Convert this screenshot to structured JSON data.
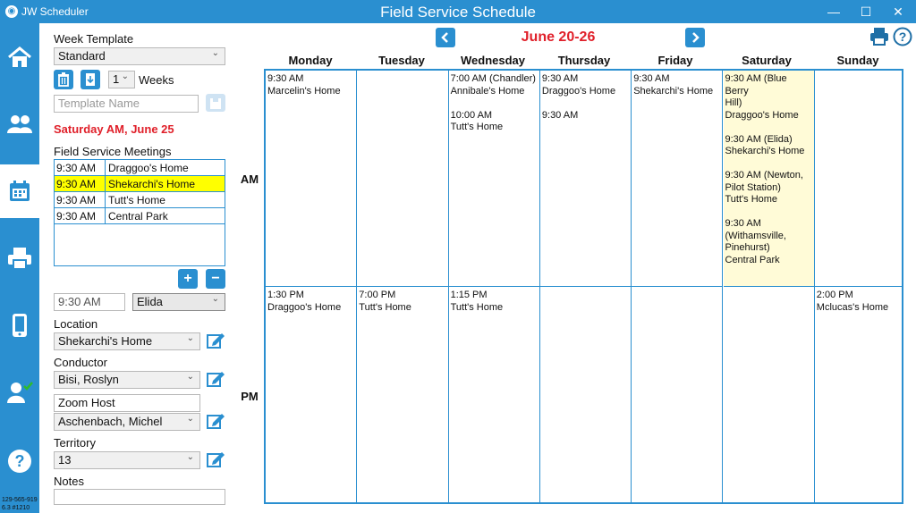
{
  "titlebar": {
    "app_name": "JW Scheduler",
    "window_title": "Field Service Schedule"
  },
  "sidebar": {
    "items": [
      {
        "icon": "home-icon"
      },
      {
        "icon": "users-icon"
      },
      {
        "icon": "calendar-icon"
      },
      {
        "icon": "printer-icon"
      },
      {
        "icon": "phone-icon"
      },
      {
        "icon": "user-check-icon"
      },
      {
        "icon": "help-icon"
      }
    ],
    "version_line1": "129-565-919",
    "version_line2": "6.3 #1210"
  },
  "panel": {
    "week_template_label": "Week Template",
    "week_template_value": "Standard",
    "weeks_count": "1",
    "weeks_label": "Weeks",
    "template_name_placeholder": "Template Name",
    "selected_date": "Saturday AM, June 25",
    "meetings_label": "Field Service Meetings",
    "meetings": [
      {
        "time": "9:30 AM",
        "location": "Draggoo's Home",
        "selected": false
      },
      {
        "time": "9:30 AM",
        "location": "Shekarchi's Home",
        "selected": true
      },
      {
        "time": "9:30 AM",
        "location": "Tutt's Home",
        "selected": false
      },
      {
        "time": "9:30 AM",
        "location": "Central Park",
        "selected": false
      }
    ],
    "time_value": "9:30 AM",
    "group_value": "Elida",
    "location_label": "Location",
    "location_value": "Shekarchi's Home",
    "conductor_label": "Conductor",
    "conductor_value": "Bisi, Roslyn",
    "zoom_host_label": "Zoom Host",
    "zoom_host_value": "Aschenbach, Michel",
    "territory_label": "Territory",
    "territory_value": "13",
    "notes_label": "Notes",
    "notes_value": ""
  },
  "schedule": {
    "week_range": "June 20-26",
    "am_label": "AM",
    "pm_label": "PM",
    "days": [
      "Monday",
      "Tuesday",
      "Wednesday",
      "Thursday",
      "Friday",
      "Saturday",
      "Sunday"
    ],
    "highlight_color": "#fffbd7",
    "accent_color": "#2a8fd0",
    "am": [
      [
        "9:30 AM\nMarcelin's Home"
      ],
      [],
      [
        "7:00 AM (Chandler)\nAnnibale's Home",
        "10:00 AM\nTutt's Home"
      ],
      [
        "9:30 AM\nDraggoo's Home",
        "9:30 AM"
      ],
      [
        "9:30 AM\nShekarchi's Home"
      ],
      [
        "9:30 AM (Blue Berry\nHill)\nDraggoo's Home",
        "9:30 AM (Elida)\nShekarchi's Home",
        "9:30 AM (Newton,\nPilot Station)\nTutt's Home",
        "9:30 AM\n(Withamsville,\nPinehurst)\nCentral Park"
      ],
      []
    ],
    "pm": [
      [
        "1:30 PM\nDraggoo's Home"
      ],
      [
        "7:00 PM\nTutt's Home"
      ],
      [
        "1:15 PM\nTutt's Home"
      ],
      [],
      [],
      [],
      [
        "2:00 PM\nMclucas's Home"
      ]
    ]
  }
}
